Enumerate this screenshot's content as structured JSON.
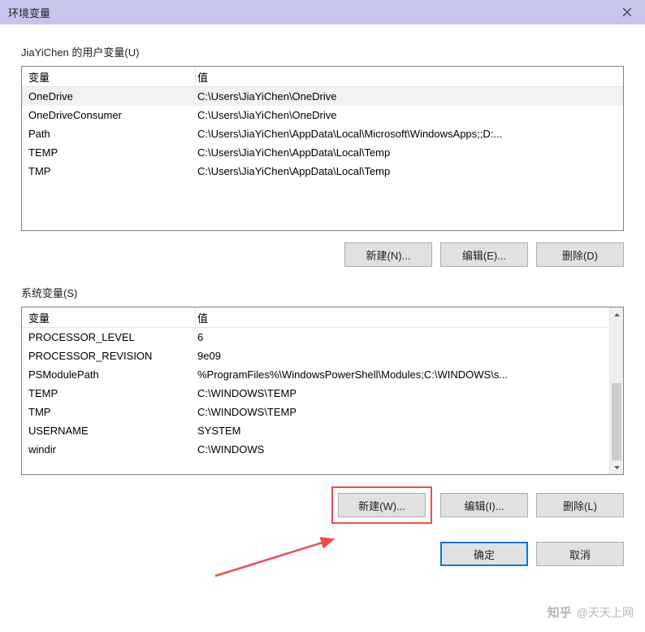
{
  "title": "环境变量",
  "user_section": {
    "label": "JiaYiChen 的用户变量(U)",
    "headers": {
      "variable": "变量",
      "value": "值"
    },
    "rows": [
      {
        "variable": "OneDrive",
        "value": "C:\\Users\\JiaYiChen\\OneDrive"
      },
      {
        "variable": "OneDriveConsumer",
        "value": "C:\\Users\\JiaYiChen\\OneDrive"
      },
      {
        "variable": "Path",
        "value": "C:\\Users\\JiaYiChen\\AppData\\Local\\Microsoft\\WindowsApps;;D:..."
      },
      {
        "variable": "TEMP",
        "value": "C:\\Users\\JiaYiChen\\AppData\\Local\\Temp"
      },
      {
        "variable": "TMP",
        "value": "C:\\Users\\JiaYiChen\\AppData\\Local\\Temp"
      }
    ],
    "buttons": {
      "new": "新建(N)...",
      "edit": "编辑(E)...",
      "delete": "删除(D)"
    }
  },
  "system_section": {
    "label": "系统变量(S)",
    "headers": {
      "variable": "变量",
      "value": "值"
    },
    "rows": [
      {
        "variable": "PROCESSOR_LEVEL",
        "value": "6"
      },
      {
        "variable": "PROCESSOR_REVISION",
        "value": "9e09"
      },
      {
        "variable": "PSModulePath",
        "value": "%ProgramFiles%\\WindowsPowerShell\\Modules;C:\\WINDOWS\\s..."
      },
      {
        "variable": "TEMP",
        "value": "C:\\WINDOWS\\TEMP"
      },
      {
        "variable": "TMP",
        "value": "C:\\WINDOWS\\TEMP"
      },
      {
        "variable": "USERNAME",
        "value": "SYSTEM"
      },
      {
        "variable": "windir",
        "value": "C:\\WINDOWS"
      }
    ],
    "buttons": {
      "new": "新建(W)...",
      "edit": "编辑(I)...",
      "delete": "删除(L)"
    }
  },
  "dialog_buttons": {
    "ok": "确定",
    "cancel": "取消"
  },
  "watermark": {
    "brand": "知乎",
    "author": "@天天上网"
  }
}
